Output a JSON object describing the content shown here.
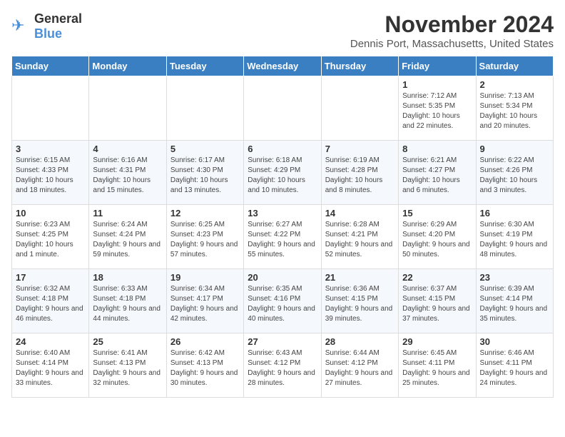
{
  "logo": {
    "general": "General",
    "blue": "Blue"
  },
  "header": {
    "month_title": "November 2024",
    "location": "Dennis Port, Massachusetts, United States"
  },
  "weekdays": [
    "Sunday",
    "Monday",
    "Tuesday",
    "Wednesday",
    "Thursday",
    "Friday",
    "Saturday"
  ],
  "weeks": [
    [
      {
        "day": "",
        "info": ""
      },
      {
        "day": "",
        "info": ""
      },
      {
        "day": "",
        "info": ""
      },
      {
        "day": "",
        "info": ""
      },
      {
        "day": "",
        "info": ""
      },
      {
        "day": "1",
        "info": "Sunrise: 7:12 AM\nSunset: 5:35 PM\nDaylight: 10 hours and 22 minutes."
      },
      {
        "day": "2",
        "info": "Sunrise: 7:13 AM\nSunset: 5:34 PM\nDaylight: 10 hours and 20 minutes."
      }
    ],
    [
      {
        "day": "3",
        "info": "Sunrise: 6:15 AM\nSunset: 4:33 PM\nDaylight: 10 hours and 18 minutes."
      },
      {
        "day": "4",
        "info": "Sunrise: 6:16 AM\nSunset: 4:31 PM\nDaylight: 10 hours and 15 minutes."
      },
      {
        "day": "5",
        "info": "Sunrise: 6:17 AM\nSunset: 4:30 PM\nDaylight: 10 hours and 13 minutes."
      },
      {
        "day": "6",
        "info": "Sunrise: 6:18 AM\nSunset: 4:29 PM\nDaylight: 10 hours and 10 minutes."
      },
      {
        "day": "7",
        "info": "Sunrise: 6:19 AM\nSunset: 4:28 PM\nDaylight: 10 hours and 8 minutes."
      },
      {
        "day": "8",
        "info": "Sunrise: 6:21 AM\nSunset: 4:27 PM\nDaylight: 10 hours and 6 minutes."
      },
      {
        "day": "9",
        "info": "Sunrise: 6:22 AM\nSunset: 4:26 PM\nDaylight: 10 hours and 3 minutes."
      }
    ],
    [
      {
        "day": "10",
        "info": "Sunrise: 6:23 AM\nSunset: 4:25 PM\nDaylight: 10 hours and 1 minute."
      },
      {
        "day": "11",
        "info": "Sunrise: 6:24 AM\nSunset: 4:24 PM\nDaylight: 9 hours and 59 minutes."
      },
      {
        "day": "12",
        "info": "Sunrise: 6:25 AM\nSunset: 4:23 PM\nDaylight: 9 hours and 57 minutes."
      },
      {
        "day": "13",
        "info": "Sunrise: 6:27 AM\nSunset: 4:22 PM\nDaylight: 9 hours and 55 minutes."
      },
      {
        "day": "14",
        "info": "Sunrise: 6:28 AM\nSunset: 4:21 PM\nDaylight: 9 hours and 52 minutes."
      },
      {
        "day": "15",
        "info": "Sunrise: 6:29 AM\nSunset: 4:20 PM\nDaylight: 9 hours and 50 minutes."
      },
      {
        "day": "16",
        "info": "Sunrise: 6:30 AM\nSunset: 4:19 PM\nDaylight: 9 hours and 48 minutes."
      }
    ],
    [
      {
        "day": "17",
        "info": "Sunrise: 6:32 AM\nSunset: 4:18 PM\nDaylight: 9 hours and 46 minutes."
      },
      {
        "day": "18",
        "info": "Sunrise: 6:33 AM\nSunset: 4:18 PM\nDaylight: 9 hours and 44 minutes."
      },
      {
        "day": "19",
        "info": "Sunrise: 6:34 AM\nSunset: 4:17 PM\nDaylight: 9 hours and 42 minutes."
      },
      {
        "day": "20",
        "info": "Sunrise: 6:35 AM\nSunset: 4:16 PM\nDaylight: 9 hours and 40 minutes."
      },
      {
        "day": "21",
        "info": "Sunrise: 6:36 AM\nSunset: 4:15 PM\nDaylight: 9 hours and 39 minutes."
      },
      {
        "day": "22",
        "info": "Sunrise: 6:37 AM\nSunset: 4:15 PM\nDaylight: 9 hours and 37 minutes."
      },
      {
        "day": "23",
        "info": "Sunrise: 6:39 AM\nSunset: 4:14 PM\nDaylight: 9 hours and 35 minutes."
      }
    ],
    [
      {
        "day": "24",
        "info": "Sunrise: 6:40 AM\nSunset: 4:14 PM\nDaylight: 9 hours and 33 minutes."
      },
      {
        "day": "25",
        "info": "Sunrise: 6:41 AM\nSunset: 4:13 PM\nDaylight: 9 hours and 32 minutes."
      },
      {
        "day": "26",
        "info": "Sunrise: 6:42 AM\nSunset: 4:13 PM\nDaylight: 9 hours and 30 minutes."
      },
      {
        "day": "27",
        "info": "Sunrise: 6:43 AM\nSunset: 4:12 PM\nDaylight: 9 hours and 28 minutes."
      },
      {
        "day": "28",
        "info": "Sunrise: 6:44 AM\nSunset: 4:12 PM\nDaylight: 9 hours and 27 minutes."
      },
      {
        "day": "29",
        "info": "Sunrise: 6:45 AM\nSunset: 4:11 PM\nDaylight: 9 hours and 25 minutes."
      },
      {
        "day": "30",
        "info": "Sunrise: 6:46 AM\nSunset: 4:11 PM\nDaylight: 9 hours and 24 minutes."
      }
    ]
  ]
}
